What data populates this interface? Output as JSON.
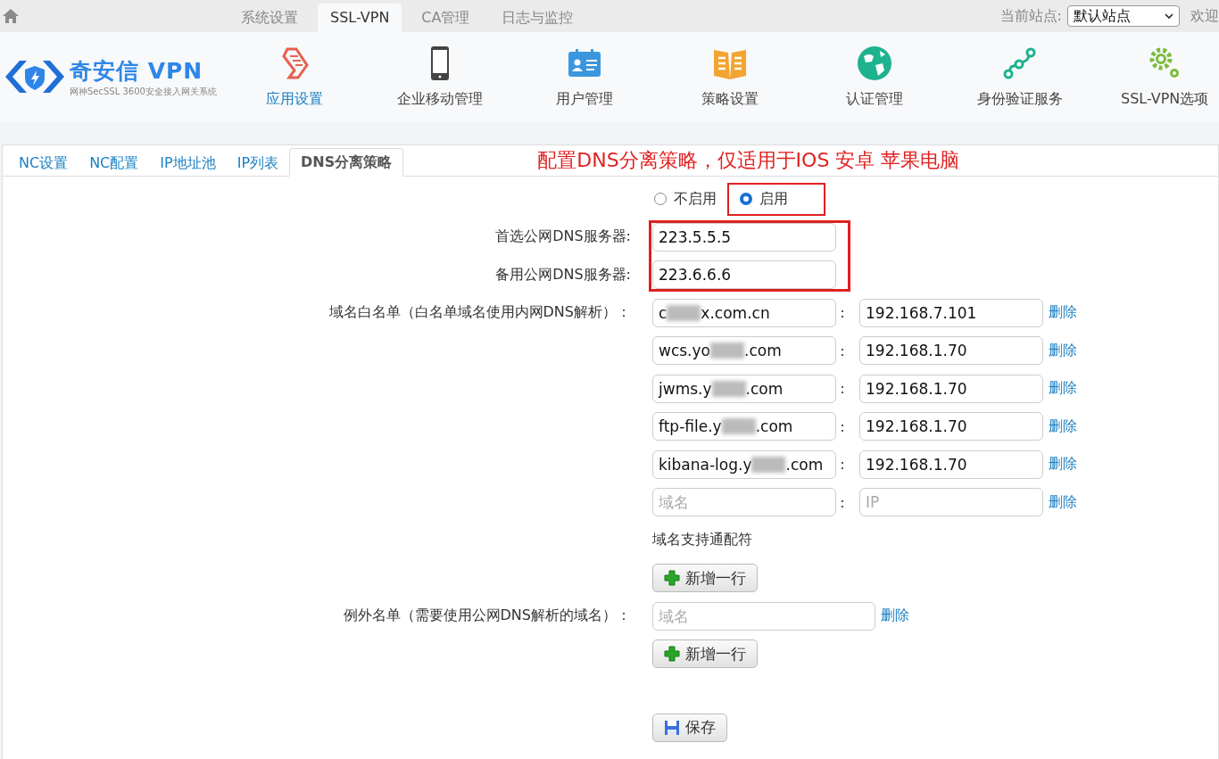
{
  "top_tabs": [
    {
      "label": "系统设置",
      "selected": false
    },
    {
      "label": "SSL-VPN",
      "selected": true
    },
    {
      "label": "CA管理",
      "selected": false
    },
    {
      "label": "日志与监控",
      "selected": false
    }
  ],
  "site": {
    "label": "当前站点:",
    "value": "默认站点",
    "welcome": "欢迎"
  },
  "logo": {
    "name": "奇安信 VPN",
    "subtitle": "网神SecSSL 3600安全接入网关系统"
  },
  "nav": [
    {
      "label": "应用设置",
      "kind": "scroll",
      "selected": true
    },
    {
      "label": "企业移动管理",
      "kind": "phone",
      "selected": false
    },
    {
      "label": "用户管理",
      "kind": "card",
      "selected": false
    },
    {
      "label": "策略设置",
      "kind": "book",
      "selected": false
    },
    {
      "label": "认证管理",
      "kind": "globe",
      "selected": false
    },
    {
      "label": "身份验证服务",
      "kind": "nodes",
      "selected": false
    },
    {
      "label": "SSL-VPN选项",
      "kind": "gears",
      "selected": false
    }
  ],
  "sub_tabs": [
    {
      "label": "NC设置",
      "selected": false
    },
    {
      "label": "NC配置",
      "selected": false
    },
    {
      "label": "IP地址池",
      "selected": false
    },
    {
      "label": "IP列表",
      "selected": false
    },
    {
      "label": "DNS分离策略",
      "selected": true
    }
  ],
  "annotation": "配置DNS分离策略，仅适用于IOS 安卓 苹果电脑",
  "mode": [
    {
      "label": "不启用",
      "selected": false
    },
    {
      "label": "启用",
      "selected": true
    }
  ],
  "primary_dns": {
    "label": "首选公网DNS服务器:",
    "value": "223.5.5.5"
  },
  "backup_dns": {
    "label": "备用公网DNS服务器:",
    "value": "223.6.6.6"
  },
  "whitelist": {
    "label": "域名白名单（白名单域名使用内网DNS解析）：",
    "rows": [
      {
        "domain_start": "c",
        "domain_end": "x.com.cn",
        "ip": "192.168.7.101",
        "delete": "删除"
      },
      {
        "domain_start": "wcs.yo",
        "domain_end": ".com",
        "ip": "192.168.1.70",
        "delete": "删除"
      },
      {
        "domain_start": "jwms.y",
        "domain_end": ".com",
        "ip": "192.168.1.70",
        "delete": "删除"
      },
      {
        "domain_start": "ftp-file.y",
        "domain_end": ".com",
        "ip": "192.168.1.70",
        "delete": "删除"
      },
      {
        "domain_start": "kibana-log.y",
        "domain_end": ".com",
        "ip": "192.168.1.70",
        "delete": "删除"
      },
      {
        "domain_placeholder": "域名",
        "ip_placeholder": "IP",
        "delete": "删除"
      }
    ],
    "separator": ":",
    "hint": "域名支持通配符",
    "add": "新增一行"
  },
  "exceptions": {
    "label": "例外名单（需要使用公网DNS解析的域名）：",
    "placeholder": "域名",
    "delete": "删除",
    "add": "新增一行"
  },
  "save": "保存"
}
